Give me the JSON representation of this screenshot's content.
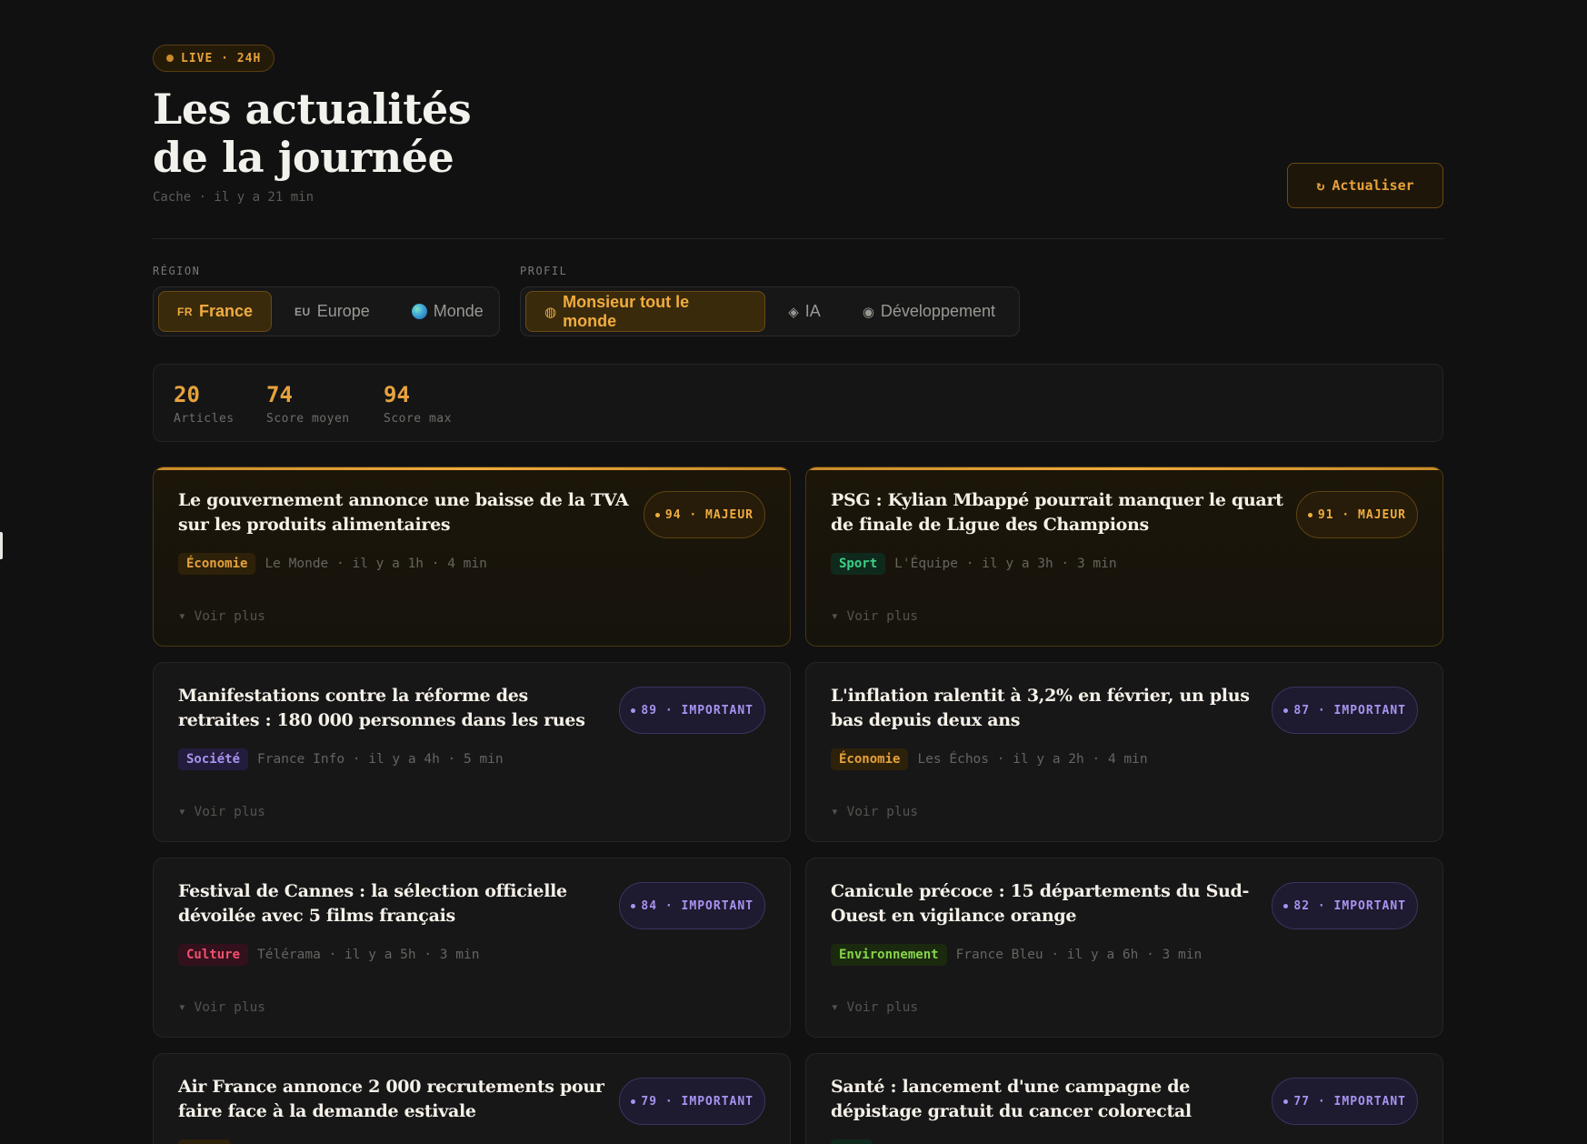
{
  "header": {
    "live_badge": "LIVE · 24H",
    "title_line1": "Les actualités",
    "title_line2": "de la journée",
    "cache_status": "Cache · il y a 21 min",
    "refresh_icon": "↻",
    "refresh_label": "Actualiser"
  },
  "filters": {
    "region_label": "RÉGION",
    "regions": [
      {
        "flag": "FR",
        "label": "France",
        "active": true
      },
      {
        "flag": "EU",
        "label": "Europe",
        "active": false
      },
      {
        "icon": "globe-icon",
        "label": "Monde",
        "active": false
      }
    ],
    "profile_label": "PROFIL",
    "profiles": [
      {
        "symbol": "◍",
        "label": "Monsieur tout le monde",
        "active": true
      },
      {
        "symbol": "◈",
        "label": "IA",
        "active": false
      },
      {
        "symbol": "◉",
        "label": "Développement",
        "active": false
      }
    ]
  },
  "stats": [
    {
      "value": "20",
      "label": "Articles"
    },
    {
      "value": "74",
      "label": "Score moyen"
    },
    {
      "value": "94",
      "label": "Score max"
    }
  ],
  "articles": [
    {
      "title": "Le gouvernement annonce une baisse de la TVA sur les produits alimentaires",
      "score": "94 · MAJEUR",
      "level": "major",
      "category": "Économie",
      "cat_class": "eco",
      "meta": "Le Monde · il y a 1h · 4 min",
      "more": "▾ Voir plus"
    },
    {
      "title": "PSG : Kylian Mbappé pourrait manquer le quart de finale de Ligue des Champions",
      "score": "91 · MAJEUR",
      "level": "major",
      "category": "Sport",
      "cat_class": "sport",
      "meta": "L'Équipe · il y a 3h · 3 min",
      "more": "▾ Voir plus"
    },
    {
      "title": "Manifestations contre la réforme des retraites : 180 000 personnes dans les rues",
      "score": "89 · IMPORTANT",
      "level": "important",
      "category": "Société",
      "cat_class": "soc",
      "meta": "France Info · il y a 4h · 5 min",
      "more": "▾ Voir plus"
    },
    {
      "title": "L'inflation ralentit à 3,2% en février, un plus bas depuis deux ans",
      "score": "87 · IMPORTANT",
      "level": "important",
      "category": "Économie",
      "cat_class": "eco",
      "meta": "Les Échos · il y a 2h · 4 min",
      "more": "▾ Voir plus"
    },
    {
      "title": "Festival de Cannes : la sélection officielle dévoilée avec 5 films français",
      "score": "84 · IMPORTANT",
      "level": "important",
      "category": "Culture",
      "cat_class": "cult",
      "meta": "Télérama · il y a 5h · 3 min",
      "more": "▾ Voir plus"
    },
    {
      "title": "Canicule précoce : 15 départements du Sud-Ouest en vigilance orange",
      "score": "82 · IMPORTANT",
      "level": "important",
      "category": "Environnement",
      "cat_class": "env",
      "meta": "France Bleu · il y a 6h · 3 min",
      "more": "▾ Voir plus"
    },
    {
      "title": "Air France annonce 2 000 recrutements pour faire face à la demande estivale",
      "score": "79 · IMPORTANT",
      "level": "important",
      "category": "",
      "cat_class": "eco",
      "meta": "",
      "more": ""
    },
    {
      "title": "Santé : lancement d'une campagne de dépistage gratuit du cancer colorectal",
      "score": "77 · IMPORTANT",
      "level": "important",
      "category": "",
      "cat_class": "sport",
      "meta": "",
      "more": ""
    }
  ],
  "colors": {
    "accent": "#e6a23c",
    "important": "#a893f0",
    "background": "#111112"
  }
}
